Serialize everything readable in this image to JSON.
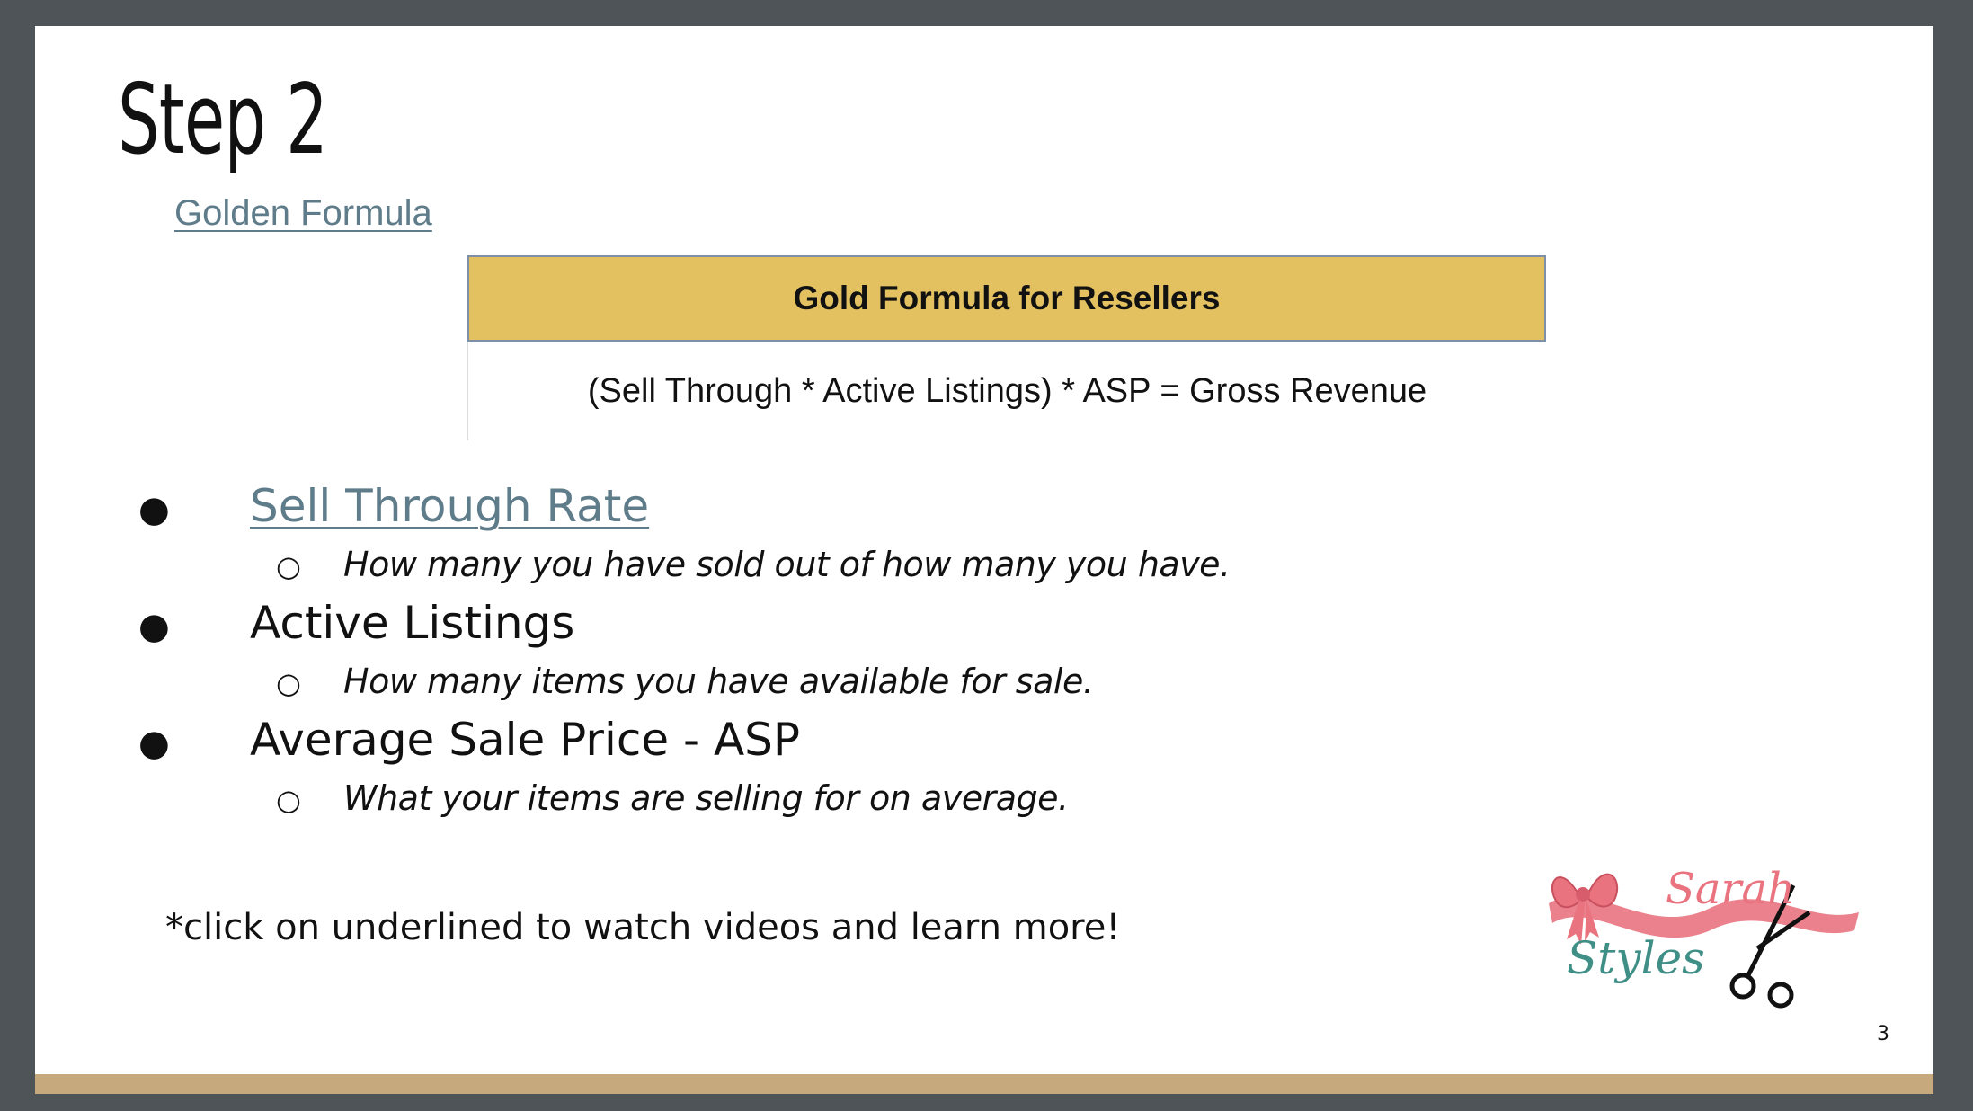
{
  "slide": {
    "title": "Step 2",
    "golden_link": "Golden Formula",
    "table": {
      "header": "Gold Formula for Resellers",
      "formula": "(Sell Through * Active Listings) * ASP = Gross Revenue"
    },
    "bullets": [
      {
        "label": "Sell Through Rate",
        "description": "How many you have sold out of how many you have."
      },
      {
        "label": "Active Listings",
        "description": "How many items you have available for sale."
      },
      {
        "label": "Average Sale Price - ASP",
        "description": "What your items are selling for on average."
      }
    ],
    "note": "*click on underlined to watch videos and learn more!",
    "page_number": "3",
    "logo": {
      "line1": "Sarah",
      "line2": "Styles"
    }
  },
  "colors": {
    "background": "#4f5458",
    "slide": "#ffffff",
    "header_gold": "#e3c161",
    "link": "#5f7c8a",
    "bottom_bar": "#c6a97d",
    "logo_pink": "#e9737f",
    "logo_teal": "#3f8f87"
  },
  "icons": [
    "bullet-dot-icon",
    "bullet-circle-icon",
    "bow-icon",
    "scissors-icon"
  ]
}
